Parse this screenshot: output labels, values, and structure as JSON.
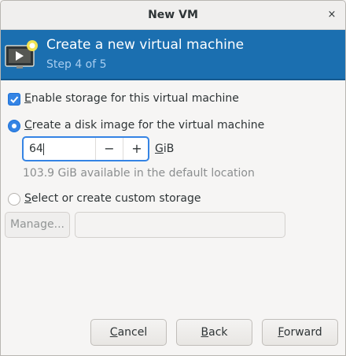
{
  "window": {
    "title": "New VM",
    "close_glyph": "×"
  },
  "banner": {
    "icon": "vm-monitor-icon",
    "title": "Create a new virtual machine",
    "step": "Step 4 of 5"
  },
  "storage": {
    "enable_label_mnemonic": "E",
    "enable_label_rest": "nable storage for this virtual machine",
    "enable_checked": true,
    "create_label_mnemonic": "C",
    "create_label_rest": "reate a disk image for the virtual machine",
    "create_selected": true,
    "size_value": "64",
    "size_unit_mnemonic": "G",
    "size_unit_rest": "iB",
    "minus_glyph": "−",
    "plus_glyph": "+",
    "available_text": "103.9 GiB available in the default location",
    "custom_label_mnemonic": "S",
    "custom_label_rest": "elect or create custom storage",
    "custom_selected": false,
    "manage_label": "Manage...",
    "path_value": ""
  },
  "footer": {
    "cancel_mnemonic": "C",
    "cancel_rest": "ancel",
    "back_mnemonic": "B",
    "back_rest": "ack",
    "forward_mnemonic": "F",
    "forward_rest": "orward"
  },
  "colors": {
    "accent": "#3584e4",
    "banner": "#1b6fb0"
  }
}
